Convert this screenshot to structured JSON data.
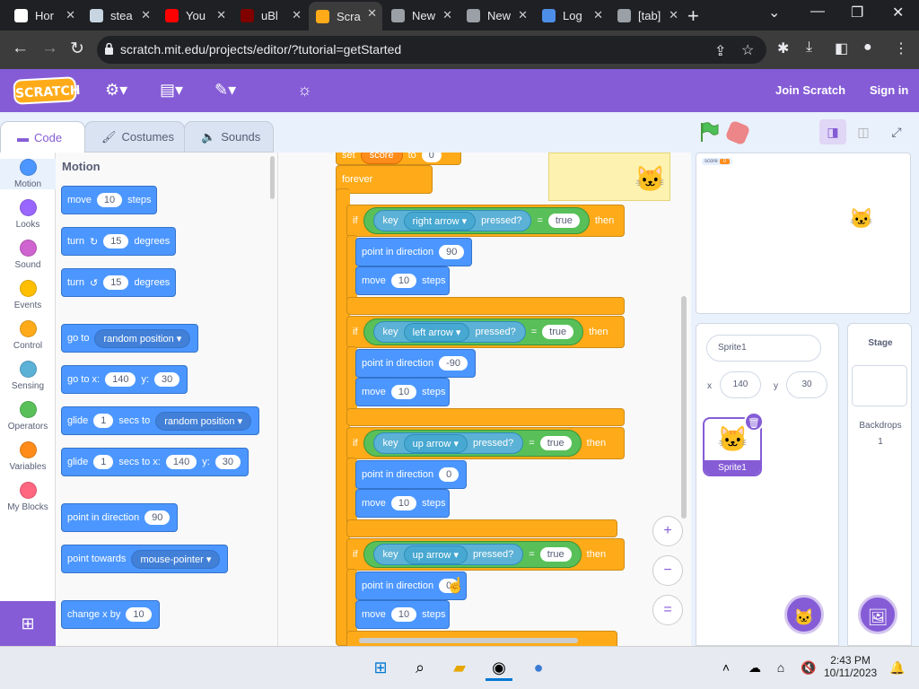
{
  "browser": {
    "tabs": [
      {
        "label": "Hor",
        "icon": "notion-icon",
        "color": "#ffffff"
      },
      {
        "label": "stea",
        "icon": "steam-icon",
        "color": "#c7d5e0"
      },
      {
        "label": "You",
        "icon": "youtube-icon",
        "color": "#ff0000"
      },
      {
        "label": "uBl",
        "icon": "ublock-icon",
        "color": "#800000"
      },
      {
        "label": "Scra",
        "icon": "scratch-icon",
        "color": "#ffab19",
        "active": true
      },
      {
        "label": "New",
        "icon": "chrome-icon",
        "color": "#9aa0a6"
      },
      {
        "label": "New",
        "icon": "chrome-icon",
        "color": "#9aa0a6"
      },
      {
        "label": "Log",
        "icon": "log-icon",
        "color": "#4d8fe8"
      },
      {
        "label": "[tab]",
        "icon": "globe-icon",
        "color": "#9aa0a6"
      }
    ],
    "url": "scratch.mit.edu/projects/editor/?tutorial=getStarted"
  },
  "scratch_menu": {
    "logo": "SCRATCH",
    "join": "Join Scratch",
    "signin": "Sign in"
  },
  "editor_tabs": {
    "code": "Code",
    "costumes": "Costumes",
    "sounds": "Sounds"
  },
  "categories": [
    {
      "label": "Motion",
      "color": "#4c97ff"
    },
    {
      "label": "Looks",
      "color": "#9966ff"
    },
    {
      "label": "Sound",
      "color": "#cf63cf"
    },
    {
      "label": "Events",
      "color": "#ffbf00"
    },
    {
      "label": "Control",
      "color": "#ffab19"
    },
    {
      "label": "Sensing",
      "color": "#5cb1d6"
    },
    {
      "label": "Operators",
      "color": "#59c059"
    },
    {
      "label": "Variables",
      "color": "#ff8c1a"
    },
    {
      "label": "My Blocks",
      "color": "#ff6680"
    }
  ],
  "palette": {
    "title": "Motion",
    "move": {
      "a": "move",
      "v": "10",
      "b": "steps"
    },
    "turn_r": {
      "a": "turn",
      "v": "15",
      "b": "degrees"
    },
    "turn_l": {
      "a": "turn",
      "v": "15",
      "b": "degrees"
    },
    "goto": {
      "a": "go to",
      "dd": "random position"
    },
    "gotoxy": {
      "a": "go to x:",
      "x": "140",
      "y_lbl": "y:",
      "y": "30"
    },
    "glide": {
      "a": "glide",
      "v": "1",
      "b": "secs to",
      "dd": "random position"
    },
    "glidexy": {
      "a": "glide",
      "v": "1",
      "b": "secs to x:",
      "x": "140",
      "y_lbl": "y:",
      "y": "30"
    },
    "point": {
      "a": "point in direction",
      "v": "90"
    },
    "towards": {
      "a": "point towards",
      "dd": "mouse-pointer"
    },
    "changex": {
      "a": "change x by",
      "v": "10"
    }
  },
  "script": {
    "top_partial": {
      "a": "set",
      "b": "score",
      "c": "to",
      "v": "0"
    },
    "forever": "forever",
    "ifs": [
      {
        "if": "if",
        "key": "key",
        "dd": "right arrow",
        "pressed": "pressed?",
        "eq": "=",
        "val": "true",
        "then": "then",
        "dir_lbl": "point in direction",
        "dir": "90",
        "move": "move",
        "steps_v": "10",
        "steps": "steps"
      },
      {
        "if": "if",
        "key": "key",
        "dd": "left arrow",
        "pressed": "pressed?",
        "eq": "=",
        "val": "true",
        "then": "then",
        "dir_lbl": "point in direction",
        "dir": "-90",
        "move": "move",
        "steps_v": "10",
        "steps": "steps"
      },
      {
        "if": "if",
        "key": "key",
        "dd": "up arrow",
        "pressed": "pressed?",
        "eq": "=",
        "val": "true",
        "then": "then",
        "dir_lbl": "point in direction",
        "dir": "0",
        "move": "move",
        "steps_v": "10",
        "steps": "steps"
      },
      {
        "if": "if",
        "key": "key",
        "dd": "up arrow",
        "pressed": "pressed?",
        "eq": "=",
        "val": "true",
        "then": "then",
        "dir_lbl": "point in direction",
        "dir": "0",
        "move": "move",
        "steps_v": "10",
        "steps": "steps"
      }
    ]
  },
  "zoom": {
    "in": "+",
    "out": "−",
    "reset": "="
  },
  "stage": {
    "score_lbl": "score",
    "score_val": "0"
  },
  "sprite_info": {
    "name": "Sprite1",
    "x_lbl": "x",
    "x": "140",
    "y_lbl": "y",
    "y": "30",
    "thumb_label": "Sprite1"
  },
  "stage_panel": {
    "title": "Stage",
    "backdrops": "Backdrops",
    "count": "1"
  },
  "taskbar": {
    "time": "2:43 PM",
    "date": "10/11/2023"
  }
}
